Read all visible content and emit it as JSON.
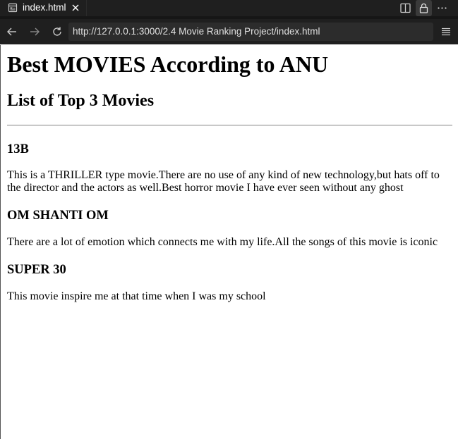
{
  "tab": {
    "title": "index.html",
    "page_icon": "page-icon",
    "close_icon": "close-icon"
  },
  "toolbar": {
    "icons": [
      "split-editor-icon",
      "lock-icon",
      "more-icon"
    ]
  },
  "address_bar": {
    "url": "http://127.0.0.1:3000/2.4 Movie Ranking Project/index.html",
    "back_icon": "arrow-left-icon",
    "forward_icon": "arrow-right-icon",
    "reload_icon": "reload-icon",
    "menu_icon": "hamburger-icon"
  },
  "page": {
    "title": "Best MOVIES According to ANU",
    "subtitle": "List of Top 3 Movies",
    "movies": [
      {
        "name": "13B",
        "description": "This is a THRILLER type movie.There are no use of any kind of new technology,but hats off to the director and the actors as well.Best horror movie I have ever seen without any ghost"
      },
      {
        "name": "OM SHANTI OM",
        "description": "There are a lot of emotion which connects me with my life.All the songs of this movie is iconic"
      },
      {
        "name": "SUPER 30",
        "description": "This movie inspire me at that time when I was my school"
      }
    ]
  },
  "colors": {
    "chrome": "#1f1f1f",
    "url_field": "#2c2c2c",
    "page_bg": "#ffffff"
  }
}
